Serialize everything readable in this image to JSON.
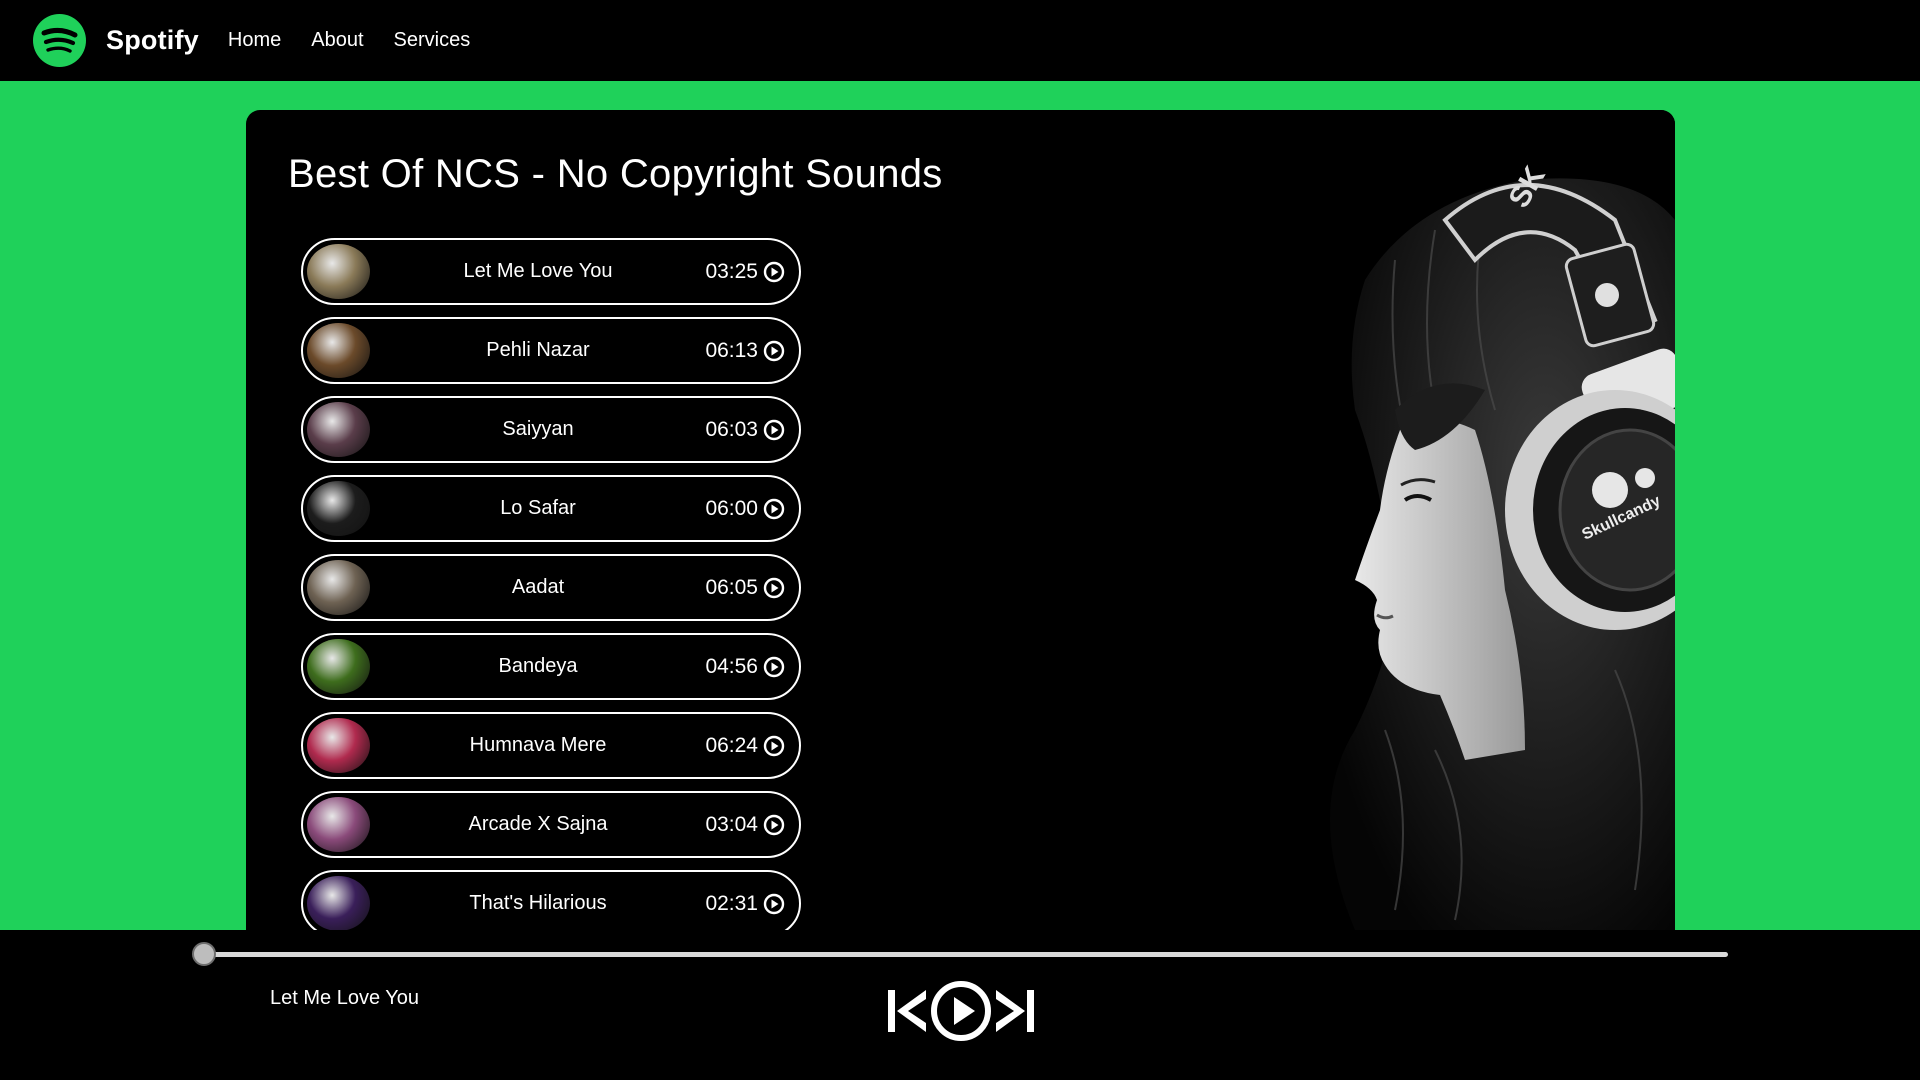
{
  "nav": {
    "brand": "Spotify",
    "links": [
      "Home",
      "About",
      "Services"
    ]
  },
  "playlist": {
    "title": "Best Of NCS - No Copyright Sounds",
    "songs": [
      {
        "name": "Let Me Love You",
        "duration": "03:25",
        "thumb_color": "#8a7a58"
      },
      {
        "name": "Pehli Nazar",
        "duration": "06:13",
        "thumb_color": "#6b4a2a"
      },
      {
        "name": "Saiyyan",
        "duration": "06:03",
        "thumb_color": "#5a3d4a"
      },
      {
        "name": "Lo Safar",
        "duration": "06:00",
        "thumb_color": "#1c1c1c"
      },
      {
        "name": "Aadat",
        "duration": "06:05",
        "thumb_color": "#6e6253"
      },
      {
        "name": "Bandeya",
        "duration": "04:56",
        "thumb_color": "#3e6d1d"
      },
      {
        "name": "Humnava Mere",
        "duration": "06:24",
        "thumb_color": "#b02a4e"
      },
      {
        "name": "Arcade X Sajna",
        "duration": "03:04",
        "thumb_color": "#8a4a7a"
      },
      {
        "name": "That's Hilarious",
        "duration": "02:31",
        "thumb_color": "#3a1f5a"
      }
    ]
  },
  "player": {
    "now_playing": "Let Me Love You",
    "progress": 0
  },
  "colors": {
    "accent": "#1fd15a",
    "background": "#000000"
  },
  "icons": {
    "logo": "spotify-logo-icon",
    "play": "play-circle-icon",
    "previous": "skip-previous-icon",
    "next": "skip-next-icon"
  }
}
